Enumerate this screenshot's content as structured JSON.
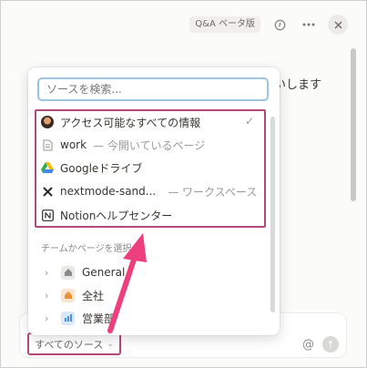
{
  "topbar": {
    "badge": "Q&A ベータ版",
    "history_icon": "clock-icon",
    "more_icon": "more-icon",
    "close_icon": "close-icon"
  },
  "background": {
    "partial_text": "いします"
  },
  "dropdown": {
    "search_placeholder": "ソースを検索...",
    "items": [
      {
        "label": "アクセス可能なすべての情報",
        "sub": "",
        "icon": "avatar-icon",
        "checked": true
      },
      {
        "label": "work",
        "sub": "— 今開いているページ",
        "icon": "page-icon"
      },
      {
        "label": "Googleドライブ",
        "sub": "",
        "icon": "google-drive-icon"
      },
      {
        "label": "nextmode-sand...",
        "sub": "— ワークスペース",
        "icon": "x-icon"
      },
      {
        "label": "Notionヘルプセンター",
        "sub": "",
        "icon": "notion-icon"
      }
    ],
    "check_mark": "✓",
    "section_label": "チームかページを選択",
    "teams": [
      {
        "label": "General",
        "icon": "house-icon",
        "color": "#8a8a8a"
      },
      {
        "label": "全社",
        "icon": "house-icon",
        "color": "#e8913a"
      },
      {
        "label": "営業部",
        "icon": "chart-icon",
        "color": "#4a90d9"
      }
    ]
  },
  "composer": {
    "sources_label": "すべてのソース",
    "sources_chevron": "⌄",
    "at_icon": "@",
    "send_icon": "↑"
  },
  "colors": {
    "annotation": "#b14a7a",
    "arrow": "#ee3f7d",
    "focus": "#9fc3e8"
  }
}
